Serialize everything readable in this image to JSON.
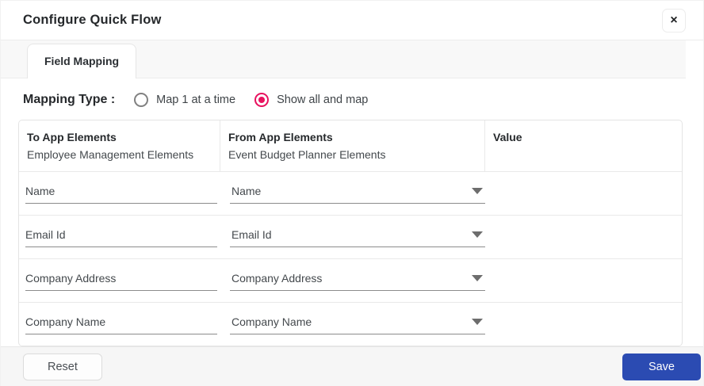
{
  "dialog": {
    "title": "Configure Quick Flow",
    "close_icon": "×"
  },
  "tabs": [
    {
      "label": "Field Mapping",
      "active": true
    }
  ],
  "mapping_type": {
    "label": "Mapping Type :",
    "options": [
      {
        "label": "Map 1 at a time",
        "selected": false
      },
      {
        "label": "Show all and map",
        "selected": true
      }
    ]
  },
  "table": {
    "columns": [
      {
        "title": "To App Elements",
        "subtitle": "Employee Management Elements"
      },
      {
        "title": "From App Elements",
        "subtitle": "Event Budget Planner Elements"
      },
      {
        "title": "Value",
        "subtitle": ""
      }
    ],
    "rows": [
      {
        "to_value": "Name",
        "from_value": "Name",
        "value": ""
      },
      {
        "to_value": "Email Id",
        "from_value": "Email Id",
        "value": ""
      },
      {
        "to_value": "Company Address",
        "from_value": "Company Address",
        "value": ""
      },
      {
        "to_value": "Company Name",
        "from_value": "Company Name",
        "value": ""
      }
    ]
  },
  "footer": {
    "reset_label": "Reset",
    "save_label": "Save"
  },
  "colors": {
    "accent_pink": "#e8125f",
    "save_blue": "#2b4bb2",
    "strip_gray": "#f8f8f8"
  }
}
